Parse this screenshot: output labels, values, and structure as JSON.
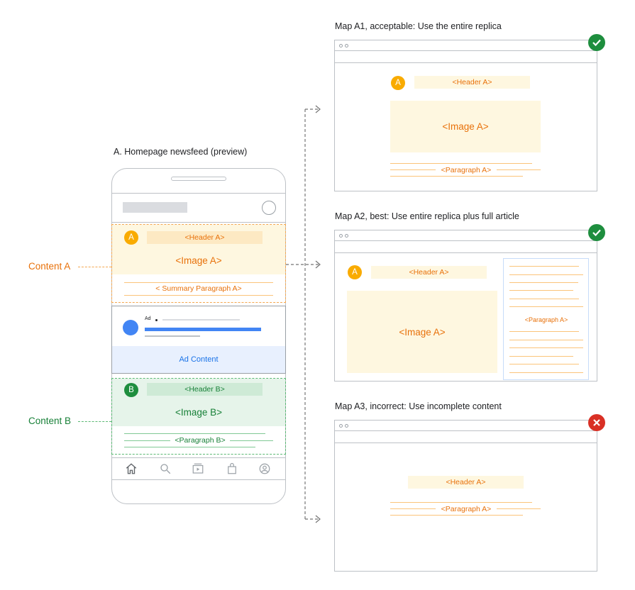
{
  "phone": {
    "title": "A. Homepage newsfeed (preview)",
    "content_a": {
      "label": "Content A",
      "badge": "A",
      "header": "<Header A>",
      "image": "<Image A>",
      "summary": "< Summary Paragraph A>"
    },
    "ad": {
      "ad_label": "Ad",
      "content": "Ad Content"
    },
    "content_b": {
      "label": "Content B",
      "badge": "B",
      "header": "<Header B>",
      "image": "<Image B>",
      "paragraph": "<Paragraph B>"
    },
    "nav_icons": [
      "home-icon",
      "search-icon",
      "video-icon",
      "shopping-bag-icon",
      "account-icon"
    ]
  },
  "maps": [
    {
      "title": "Map A1, acceptable: Use the entire replica",
      "status": "check",
      "badge": "A",
      "header": "<Header A>",
      "image": "<Image A>",
      "paragraph": "<Paragraph A>"
    },
    {
      "title": "Map A2, best: Use entire replica plus full article",
      "status": "check",
      "badge": "A",
      "header": "<Header A>",
      "image": "<Image A>",
      "paragraph": "<Paragraph A>"
    },
    {
      "title": "Map A3, incorrect: Use incomplete content",
      "status": "cross",
      "header": "<Header A>",
      "paragraph": "<Paragraph A>"
    }
  ],
  "colors": {
    "orange": "#e8710a",
    "yellow_fill": "#fef7e0",
    "green": "#188038",
    "green_fill": "#ceead6",
    "blue": "#1a73e8",
    "check": "#1e8e3e",
    "cross": "#d93025"
  }
}
